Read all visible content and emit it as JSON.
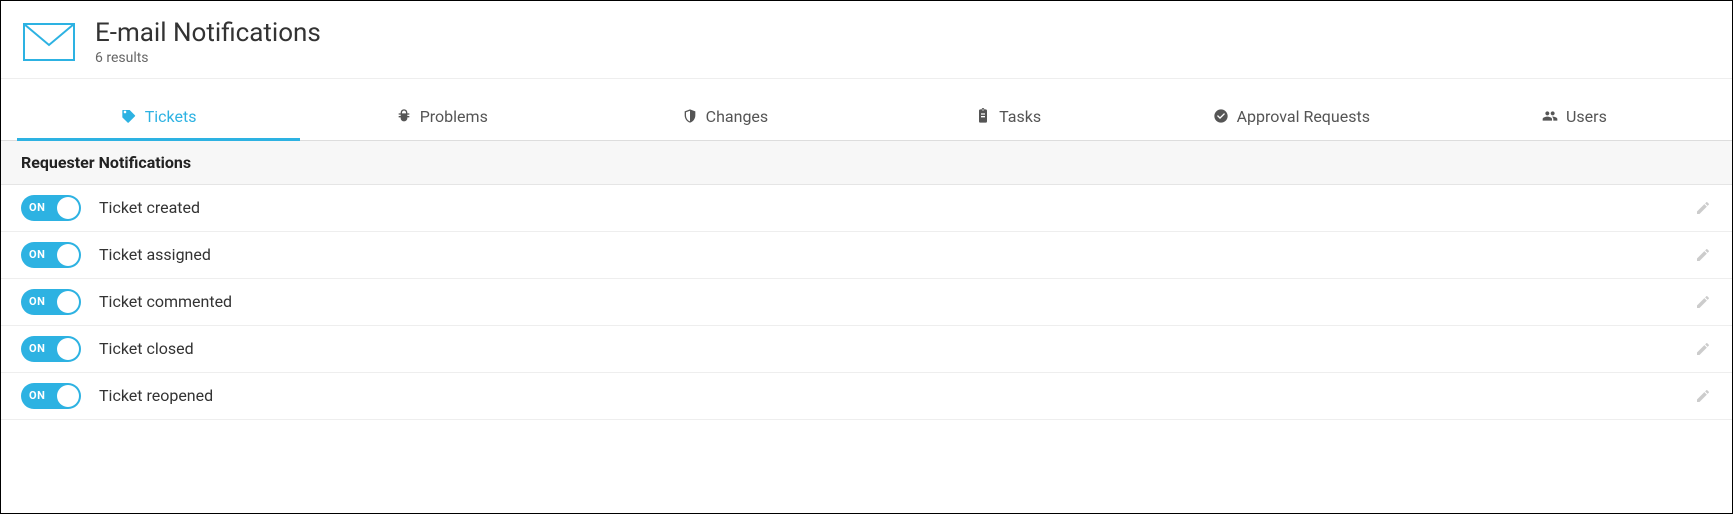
{
  "header": {
    "title": "E-mail Notifications",
    "subtitle": "6 results"
  },
  "tabs": [
    {
      "label": "Tickets",
      "icon": "tag-icon",
      "active": true
    },
    {
      "label": "Problems",
      "icon": "bug-icon",
      "active": false
    },
    {
      "label": "Changes",
      "icon": "shield-icon",
      "active": false
    },
    {
      "label": "Tasks",
      "icon": "clipboard-icon",
      "active": false
    },
    {
      "label": "Approval Requests",
      "icon": "check-circle-icon",
      "active": false
    },
    {
      "label": "Users",
      "icon": "users-icon",
      "active": false
    }
  ],
  "section": {
    "title": "Requester Notifications"
  },
  "toggle": {
    "on_label": "ON"
  },
  "notifications": [
    {
      "label": "Ticket created",
      "state": "ON"
    },
    {
      "label": "Ticket assigned",
      "state": "ON"
    },
    {
      "label": "Ticket commented",
      "state": "ON"
    },
    {
      "label": "Ticket closed",
      "state": "ON"
    },
    {
      "label": "Ticket reopened",
      "state": "ON"
    }
  ]
}
